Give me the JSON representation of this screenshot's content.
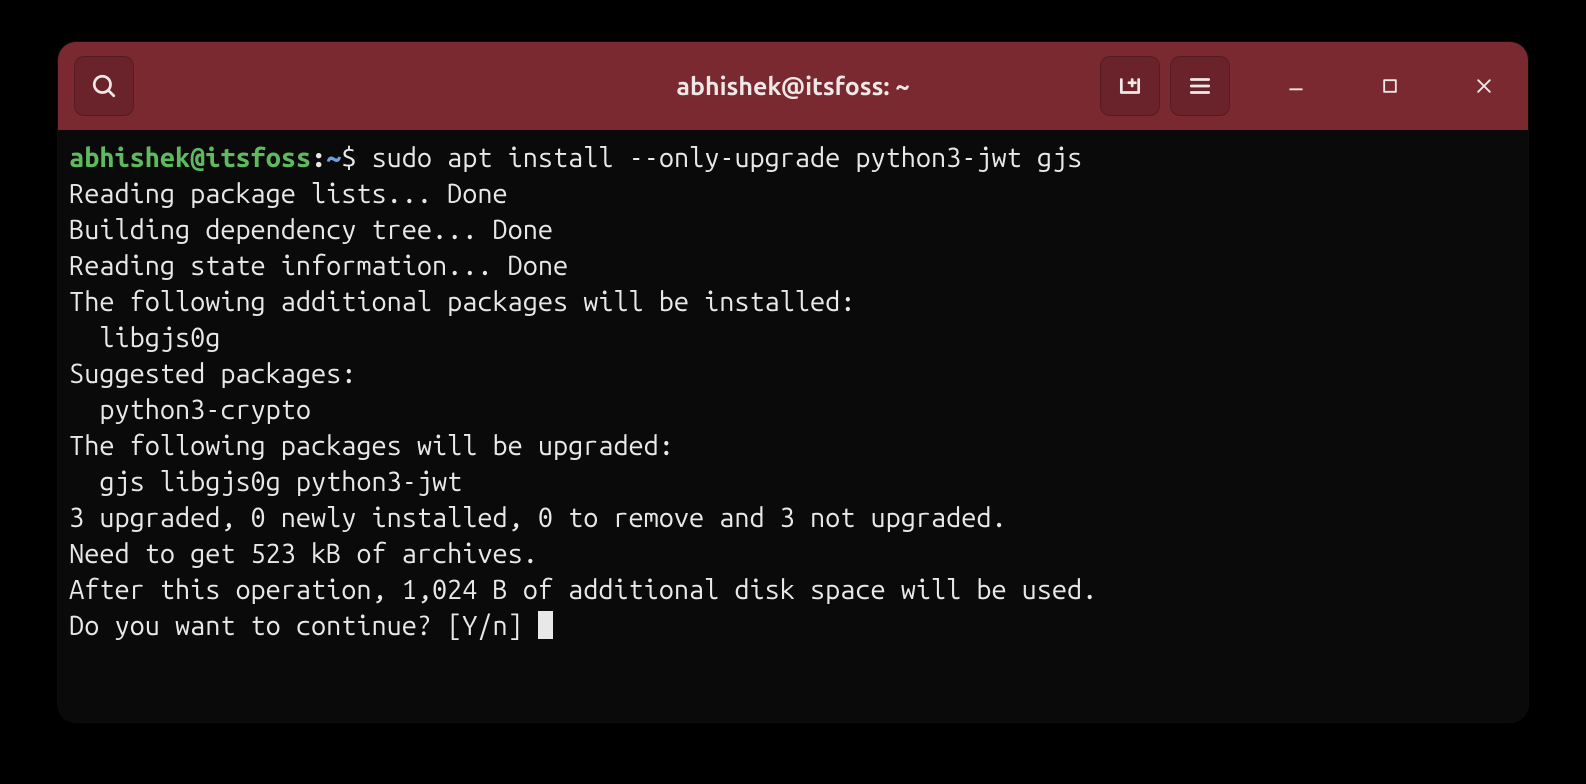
{
  "window": {
    "title": "abhishek@itsfoss: ~"
  },
  "prompt": {
    "user": "abhishek",
    "at": "@",
    "host": "itsfoss",
    "colon": ":",
    "path": "~",
    "dollar": "$"
  },
  "command": "sudo apt install --only-upgrade python3-jwt gjs",
  "output_lines": [
    "Reading package lists... Done",
    "Building dependency tree... Done",
    "Reading state information... Done",
    "The following additional packages will be installed:",
    "  libgjs0g",
    "Suggested packages:",
    "  python3-crypto",
    "The following packages will be upgraded:",
    "  gjs libgjs0g python3-jwt",
    "3 upgraded, 0 newly installed, 0 to remove and 3 not upgraded.",
    "Need to get 523 kB of archives.",
    "After this operation, 1,024 B of additional disk space will be used.",
    "Do you want to continue? [Y/n] "
  ]
}
